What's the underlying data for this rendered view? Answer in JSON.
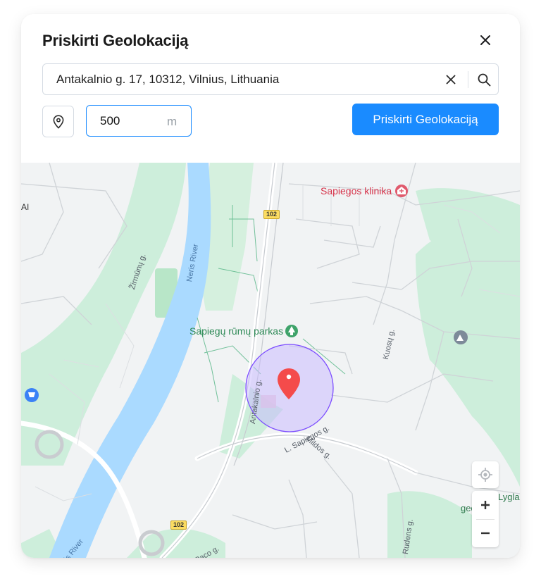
{
  "dialog": {
    "title": "Priskirti Geolokaciją",
    "close_icon": "close-icon"
  },
  "address": {
    "value": "Antakalnio g. 17, 10312, Vilnius, Lithuania",
    "clear_icon": "clear-icon",
    "search_icon": "search-icon"
  },
  "radius": {
    "value": "500",
    "unit": "m"
  },
  "actions": {
    "locate_icon": "location-pin-icon",
    "assign_label": "Priskirti Geolokaciją",
    "assign_color": "#1a8bff"
  },
  "map": {
    "labels": {
      "clinic": "Sapiegos klinika",
      "park": "Sapiegų rūmų parkas",
      "river_top": "Neris River",
      "river_bottom": "Neris River",
      "street_zirmunu": "Žirmūnų g.",
      "street_antakalnio": "Antakalnio g.",
      "street_sapiegos": "L. Sapiegos g.",
      "street_mildos": "Mildos g.",
      "street_kuosu": "Kuosų g.",
      "street_rudens": "Rudens g.",
      "street_paco": "M. K. Paco g.",
      "road_top": "102",
      "road_bottom": "102",
      "poi_lygl_1": "Lygla",
      "poi_lygl_2": "geologij",
      "edge_left": "AI"
    },
    "radius_circle_color": "#7c4dff",
    "marker_color": "#f44b4b",
    "controls": {
      "recenter_icon": "crosshair-icon",
      "zoom_in": "+",
      "zoom_out": "−"
    }
  }
}
